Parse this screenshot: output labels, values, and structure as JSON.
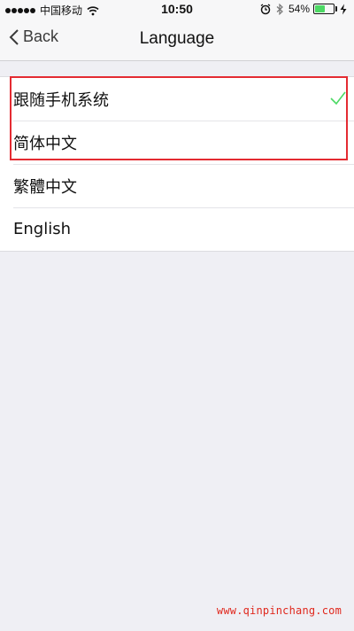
{
  "status_bar": {
    "carrier": "中国移动",
    "time": "10:50",
    "battery_percent": "54%",
    "battery_level": 0.54,
    "icons": [
      "signal-dots",
      "wifi-icon",
      "alarm-icon",
      "bluetooth-icon",
      "battery-icon",
      "charging-icon"
    ]
  },
  "nav": {
    "back_label": "Back",
    "title": "Language"
  },
  "languages": [
    {
      "label": "跟随手机系统",
      "selected": true
    },
    {
      "label": "简体中文",
      "selected": false
    },
    {
      "label": "繁體中文",
      "selected": false
    },
    {
      "label": "English",
      "selected": false
    }
  ],
  "colors": {
    "checkmark": "#4cd964",
    "highlight": "#e42b32",
    "watermark": "#e0281d"
  },
  "watermark": "www.qinpinchang.com"
}
